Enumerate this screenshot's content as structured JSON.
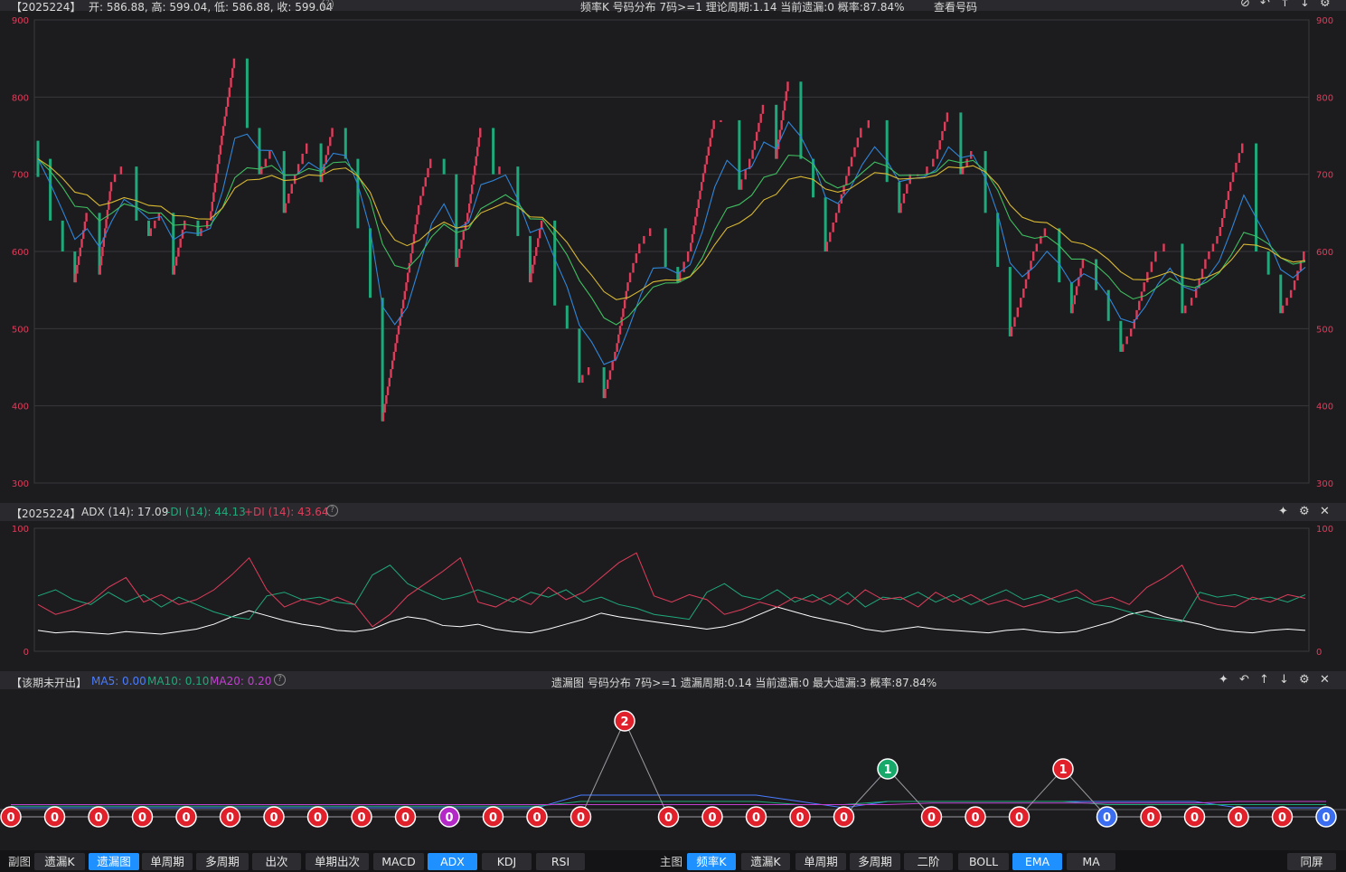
{
  "main_panel": {
    "period": "【2025224】",
    "ohlc": "开: 586.88, 高: 599.04, 低: 586.88, 收: 599.04",
    "center_text": "频率K   号码分布  7码>=1    理论周期:1.14   当前遗漏:0   概率:87.84%",
    "view_link": "查看号码",
    "y_ticks": [
      "900",
      "800",
      "700",
      "600",
      "500",
      "400",
      "300"
    ],
    "colors": {
      "up": "#e03c5a",
      "down": "#1fa97a",
      "ema_fast": "#2f86d8",
      "ema_mid": "#3fbf60",
      "ema_slow": "#d8b832"
    }
  },
  "adx_panel": {
    "period": "【2025224】",
    "adx_label": "ADX (14): 17.09",
    "minus_di_label": "-DI (14): 44.13",
    "plus_di_label": "+DI (14): 43.64",
    "y_ticks": [
      "100",
      "0"
    ],
    "colors": {
      "adx": "#ffffff",
      "minus_di": "#1fa97a",
      "plus_di": "#e03c5a"
    }
  },
  "miss_panel": {
    "title": "【该期未开出】",
    "ma5": "MA5: 0.00",
    "ma10": "MA10: 0.10",
    "ma20": "MA20: 0.20",
    "center_text": "遗漏图  号码分布  7码>=1     遗漏周期:0.14   当前遗漏:0   最大遗漏:3   概率:87.84%",
    "colors": {
      "ma5": "#4a7cff",
      "ma10": "#1fa97a",
      "ma20": "#c040d0"
    },
    "points": [
      {
        "v": 0,
        "c": "red"
      },
      {
        "v": 0,
        "c": "red"
      },
      {
        "v": 0,
        "c": "red"
      },
      {
        "v": 0,
        "c": "red"
      },
      {
        "v": 0,
        "c": "red"
      },
      {
        "v": 0,
        "c": "red"
      },
      {
        "v": 0,
        "c": "red"
      },
      {
        "v": 0,
        "c": "red"
      },
      {
        "v": 0,
        "c": "red"
      },
      {
        "v": 0,
        "c": "red"
      },
      {
        "v": 0,
        "c": "purple"
      },
      {
        "v": 0,
        "c": "red"
      },
      {
        "v": 0,
        "c": "red"
      },
      {
        "v": 0,
        "c": "red"
      },
      {
        "v": 2,
        "c": "red"
      },
      {
        "v": 0,
        "c": "red"
      },
      {
        "v": 0,
        "c": "red"
      },
      {
        "v": 0,
        "c": "red"
      },
      {
        "v": 0,
        "c": "red"
      },
      {
        "v": 0,
        "c": "red"
      },
      {
        "v": 1,
        "c": "green"
      },
      {
        "v": 0,
        "c": "red"
      },
      {
        "v": 0,
        "c": "red"
      },
      {
        "v": 0,
        "c": "red"
      },
      {
        "v": 1,
        "c": "red"
      },
      {
        "v": 0,
        "c": "blue"
      },
      {
        "v": 0,
        "c": "red"
      },
      {
        "v": 0,
        "c": "red"
      },
      {
        "v": 0,
        "c": "red"
      },
      {
        "v": 0,
        "c": "red"
      },
      {
        "v": 0,
        "c": "blue"
      }
    ]
  },
  "bottom_bar": {
    "left_label": "副图",
    "left_buttons": [
      {
        "label": "遗漏K",
        "active": false
      },
      {
        "label": "遗漏图",
        "active": true
      },
      {
        "label": "单周期",
        "active": false
      },
      {
        "label": "多周期",
        "active": false
      },
      {
        "label": "出次",
        "active": false
      },
      {
        "label": "单期出次",
        "active": false
      },
      {
        "label": "MACD",
        "active": false
      },
      {
        "label": "ADX",
        "active": true
      },
      {
        "label": "KDJ",
        "active": false
      },
      {
        "label": "RSI",
        "active": false
      }
    ],
    "right_label": "主图",
    "right_buttons": [
      {
        "label": "频率K",
        "active": true
      },
      {
        "label": "遗漏K",
        "active": false
      },
      {
        "label": "单周期",
        "active": false
      },
      {
        "label": "多周期",
        "active": false
      },
      {
        "label": "二阶",
        "active": false
      },
      {
        "label": "BOLL",
        "active": false
      },
      {
        "label": "EMA",
        "active": true
      },
      {
        "label": "MA",
        "active": false
      }
    ],
    "split_button": "同屏"
  },
  "chart_data": [
    {
      "type": "candlestick",
      "ylim": [
        300,
        900
      ],
      "grid": true,
      "series": [
        {
          "name": "close",
          "values": [
            720,
            640,
            600,
            560,
            650,
            570,
            690,
            710,
            640,
            620,
            650,
            570,
            640,
            620,
            640,
            750,
            850,
            760,
            700,
            730,
            650,
            700,
            740,
            690,
            760,
            720,
            630,
            540,
            380,
            470,
            560,
            660,
            720,
            700,
            580,
            650,
            760,
            700,
            710,
            620,
            560,
            640,
            530,
            500,
            430,
            450,
            410,
            470,
            560,
            610,
            630,
            580,
            560,
            600,
            690,
            770,
            770,
            680,
            720,
            790,
            720,
            820,
            720,
            670,
            600,
            650,
            710,
            760,
            770,
            690,
            650,
            700,
            700,
            720,
            780,
            700,
            730,
            650,
            580,
            490,
            540,
            600,
            630,
            560,
            520,
            590,
            550,
            510,
            470,
            500,
            560,
            600,
            610,
            520,
            540,
            590,
            620,
            690,
            740,
            600,
            570,
            520,
            550,
            600
          ]
        }
      ]
    },
    {
      "type": "line",
      "ylim": [
        0,
        100
      ],
      "series": [
        {
          "name": "ADX (14)",
          "values": [
            17,
            15,
            16,
            15,
            14,
            16,
            15,
            14,
            16,
            18,
            22,
            28,
            33,
            29,
            25,
            22,
            20,
            17,
            16,
            18,
            24,
            28,
            26,
            21,
            20,
            22,
            18,
            16,
            15,
            18,
            22,
            26,
            31,
            28,
            26,
            24,
            22,
            20,
            18,
            20,
            24,
            30,
            36,
            32,
            28,
            25,
            22,
            18,
            16,
            18,
            20,
            18,
            17,
            16,
            15,
            17,
            18,
            16,
            15,
            16,
            20,
            24,
            30,
            33,
            28,
            25,
            22,
            18,
            16,
            15,
            17,
            18,
            17
          ]
        },
        {
          "name": "-DI (14)",
          "values": [
            45,
            50,
            42,
            38,
            48,
            40,
            46,
            36,
            44,
            38,
            32,
            28,
            26,
            45,
            48,
            42,
            44,
            40,
            38,
            62,
            70,
            55,
            48,
            42,
            45,
            50,
            45,
            40,
            48,
            44,
            50,
            40,
            44,
            38,
            35,
            30,
            28,
            26,
            48,
            55,
            45,
            42,
            50,
            40,
            46,
            38,
            48,
            36,
            44,
            42,
            48,
            40,
            46,
            38,
            44,
            50,
            42,
            46,
            40,
            44,
            38,
            36,
            32,
            28,
            26,
            24,
            48,
            44,
            46,
            42,
            44,
            40,
            46
          ]
        },
        {
          "name": "+DI (14)",
          "values": [
            38,
            30,
            34,
            40,
            52,
            60,
            40,
            46,
            38,
            42,
            50,
            62,
            76,
            50,
            36,
            42,
            38,
            44,
            38,
            20,
            30,
            45,
            55,
            65,
            76,
            40,
            36,
            44,
            38,
            52,
            42,
            48,
            60,
            72,
            80,
            45,
            40,
            46,
            42,
            30,
            34,
            40,
            36,
            44,
            40,
            46,
            38,
            50,
            42,
            44,
            36,
            48,
            40,
            46,
            38,
            42,
            36,
            40,
            45,
            50,
            40,
            44,
            38,
            52,
            60,
            70,
            42,
            38,
            36,
            44,
            40,
            46,
            43
          ]
        }
      ]
    },
    {
      "type": "line",
      "series": [
        {
          "name": "MA5",
          "values": [
            0,
            0,
            0,
            0,
            0,
            0,
            0,
            0,
            0,
            0,
            0,
            0,
            0,
            0.4,
            0.4,
            0.4,
            0.4,
            0.4,
            0.2,
            0,
            0.2,
            0.2,
            0.2,
            0.2,
            0.2,
            0.2,
            0.2,
            0.2,
            0,
            0,
            0
          ]
        },
        {
          "name": "MA10",
          "values": [
            0.05,
            0.05,
            0.05,
            0.05,
            0.05,
            0.05,
            0.05,
            0.05,
            0.05,
            0.05,
            0.05,
            0.05,
            0.05,
            0.2,
            0.2,
            0.2,
            0.2,
            0.2,
            0.1,
            0.1,
            0.2,
            0.2,
            0.2,
            0.2,
            0.2,
            0.1,
            0.1,
            0.1,
            0.1,
            0.1,
            0.1
          ]
        },
        {
          "name": "MA20",
          "values": [
            0.1,
            0.1,
            0.1,
            0.1,
            0.1,
            0.1,
            0.1,
            0.1,
            0.1,
            0.1,
            0.1,
            0.1,
            0.1,
            0.1,
            0.1,
            0.1,
            0.1,
            0.1,
            0.1,
            0.1,
            0.1,
            0.15,
            0.15,
            0.15,
            0.15,
            0.15,
            0.15,
            0.15,
            0.2,
            0.2,
            0.2
          ]
        }
      ]
    }
  ]
}
